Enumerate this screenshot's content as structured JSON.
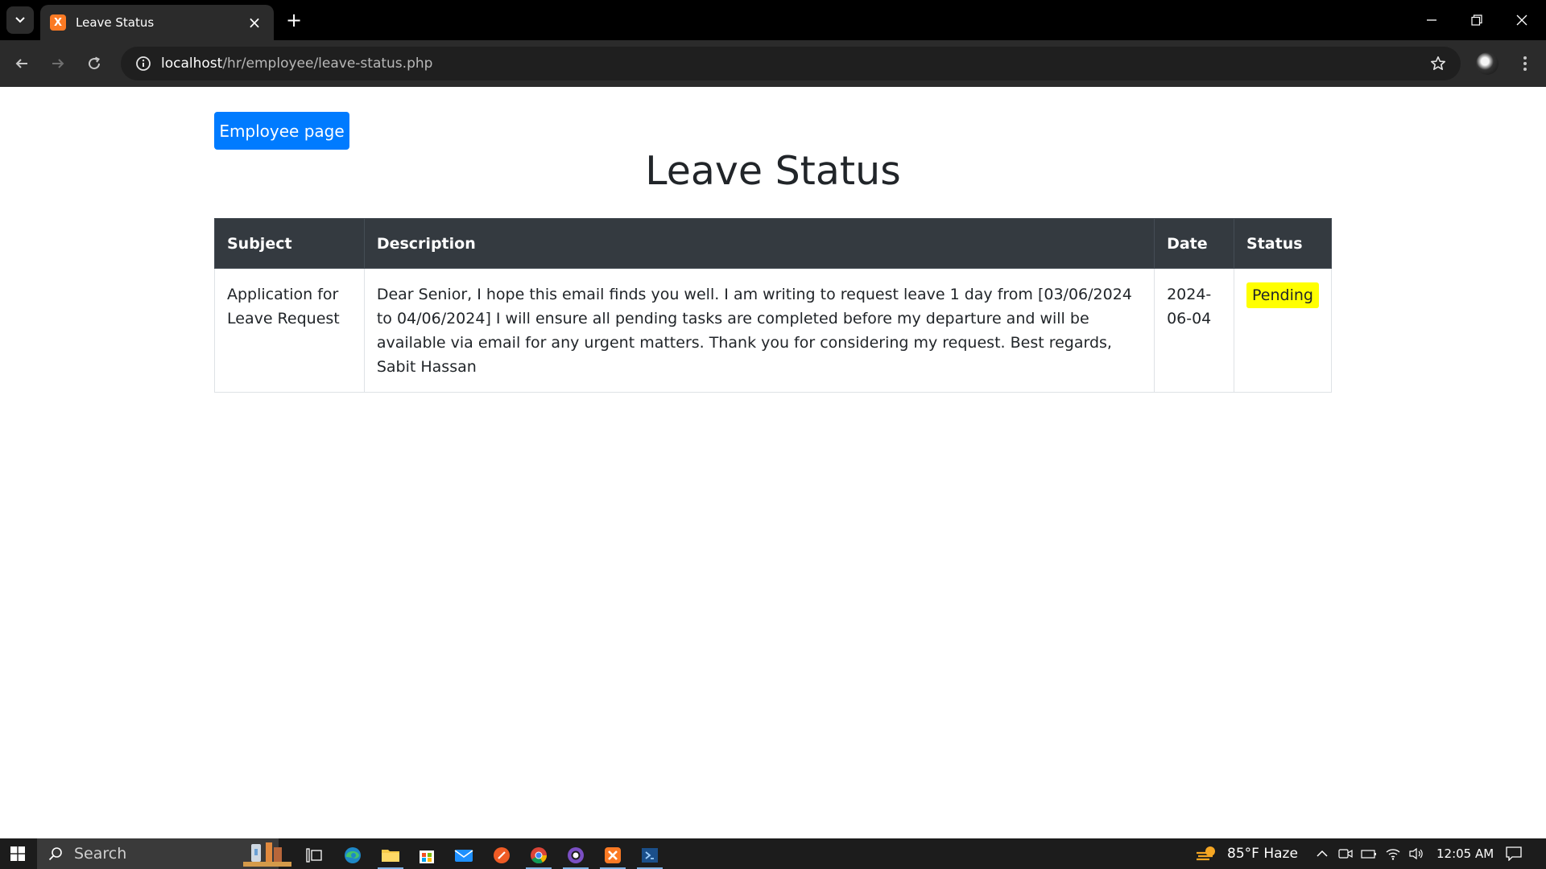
{
  "browser": {
    "tab_title": "Leave Status",
    "tab_favicon_letter": "X",
    "url_host": "localhost",
    "url_path": "/hr/employee/leave-status.php"
  },
  "page": {
    "employee_button_label": "Employee page",
    "title": "Leave Status",
    "table": {
      "headers": [
        "Subject",
        "Description",
        "Date",
        "Status"
      ],
      "rows": [
        {
          "subject": "Application for Leave Request",
          "description": "Dear Senior, I hope this email finds you well. I am writing to request leave 1 day from [03/06/2024 to 04/06/2024] I will ensure all pending tasks are completed before my departure and will be available via email for any urgent matters. Thank you for considering my request. Best regards, Sabit Hassan",
          "date": "2024-06-04",
          "status": "Pending"
        }
      ]
    }
  },
  "taskbar": {
    "search_label": "Search",
    "weather": "85°F Haze",
    "time": "12:05 AM"
  },
  "colors": {
    "primary_button": "#007bff",
    "table_header": "#343a40",
    "pending_badge": "#ffff00"
  }
}
